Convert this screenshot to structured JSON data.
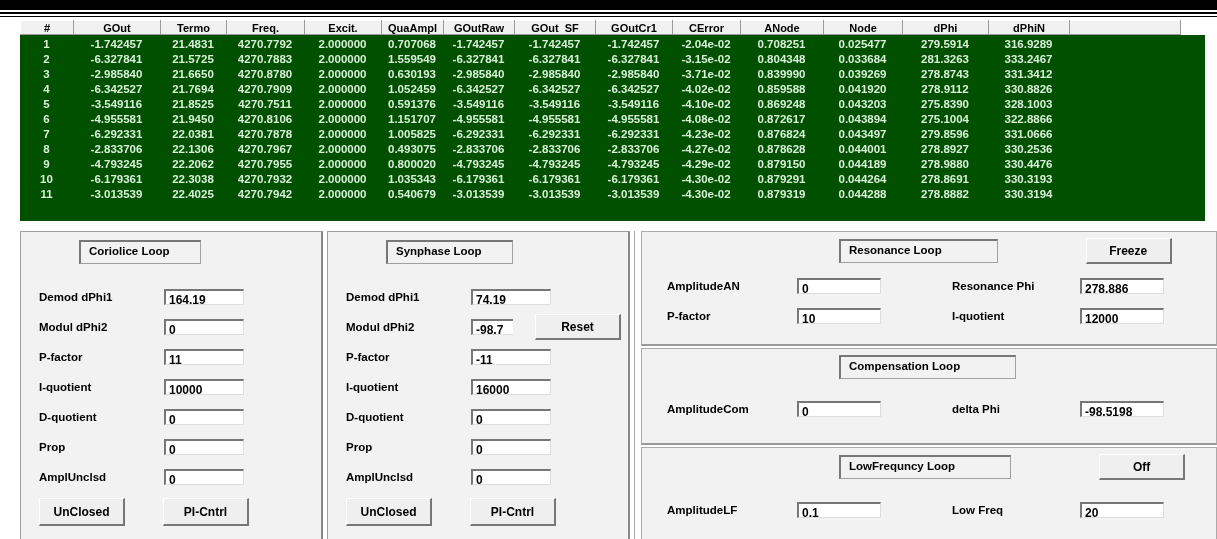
{
  "table": {
    "columns": [
      "#",
      "GOut",
      "Termo",
      "Freq.",
      "Excit.",
      "QuaAmpl",
      "GOutRaw",
      "GOut  SF",
      "GOutCr1",
      "CError",
      "ANode",
      "Node",
      "dPhi",
      "dPhiN"
    ],
    "rows": [
      [
        "1",
        "-1.742457",
        "21.4831",
        "4270.7792",
        "2.000000",
        "0.707068",
        "-1.742457",
        "-1.742457",
        "-1.742457",
        "-2.04e-02",
        "0.708251",
        "0.025477",
        "279.5914",
        "316.9289"
      ],
      [
        "2",
        "-6.327841",
        "21.5725",
        "4270.7883",
        "2.000000",
        "1.559549",
        "-6.327841",
        "-6.327841",
        "-6.327841",
        "-3.15e-02",
        "0.804348",
        "0.033684",
        "281.3263",
        "333.2467"
      ],
      [
        "3",
        "-2.985840",
        "21.6650",
        "4270.8780",
        "2.000000",
        "0.630193",
        "-2.985840",
        "-2.985840",
        "-2.985840",
        "-3.71e-02",
        "0.839990",
        "0.039269",
        "278.8743",
        "331.3412"
      ],
      [
        "4",
        "-6.342527",
        "21.7694",
        "4270.7909",
        "2.000000",
        "1.052459",
        "-6.342527",
        "-6.342527",
        "-6.342527",
        "-4.02e-02",
        "0.859588",
        "0.041920",
        "278.9112",
        "330.8826"
      ],
      [
        "5",
        "-3.549116",
        "21.8525",
        "4270.7511",
        "2.000000",
        "0.591376",
        "-3.549116",
        "-3.549116",
        "-3.549116",
        "-4.10e-02",
        "0.869248",
        "0.043203",
        "275.8390",
        "328.1003"
      ],
      [
        "6",
        "-4.955581",
        "21.9450",
        "4270.8106",
        "2.000000",
        "1.151707",
        "-4.955581",
        "-4.955581",
        "-4.955581",
        "-4.08e-02",
        "0.872617",
        "0.043894",
        "275.1004",
        "322.8866"
      ],
      [
        "7",
        "-6.292331",
        "22.0381",
        "4270.7878",
        "2.000000",
        "1.005825",
        "-6.292331",
        "-6.292331",
        "-6.292331",
        "-4.23e-02",
        "0.876824",
        "0.043497",
        "279.8596",
        "331.0666"
      ],
      [
        "8",
        "-2.833706",
        "22.1306",
        "4270.7967",
        "2.000000",
        "0.493075",
        "-2.833706",
        "-2.833706",
        "-2.833706",
        "-4.27e-02",
        "0.878628",
        "0.044001",
        "278.8927",
        "330.2536"
      ],
      [
        "9",
        "-4.793245",
        "22.2062",
        "4270.7955",
        "2.000000",
        "0.800020",
        "-4.793245",
        "-4.793245",
        "-4.793245",
        "-4.29e-02",
        "0.879150",
        "0.044189",
        "278.9880",
        "330.4476"
      ],
      [
        "10",
        "-6.179361",
        "22.3038",
        "4270.7932",
        "2.000000",
        "1.035343",
        "-6.179361",
        "-6.179361",
        "-6.179361",
        "-4.30e-02",
        "0.879291",
        "0.044264",
        "278.8691",
        "330.3193"
      ],
      [
        "11",
        "-3.013539",
        "22.4025",
        "4270.7942",
        "2.000000",
        "0.540679",
        "-3.013539",
        "-3.013539",
        "-3.013539",
        "-4.30e-02",
        "0.879319",
        "0.044288",
        "278.8882",
        "330.3194"
      ]
    ]
  },
  "loops": [
    {
      "title": "Coriolice Loop",
      "fields": [
        {
          "label": "Demod dPhi1",
          "value": "164.19"
        },
        {
          "label": "Modul dPhi2",
          "value": "0"
        },
        {
          "label": "P-factor",
          "value": "11"
        },
        {
          "label": "I-quotient",
          "value": "10000"
        },
        {
          "label": "D-quotient",
          "value": "0"
        },
        {
          "label": "Prop",
          "value": "0"
        },
        {
          "label": "AmplUnclsd",
          "value": "0"
        }
      ],
      "buttons": [
        "UnClosed",
        "PI-Cntrl"
      ]
    },
    {
      "title": "Synphase Loop",
      "fields": [
        {
          "label": "Demod dPhi1",
          "value": "74.19"
        },
        {
          "label": "Modul dPhi2",
          "value": "-98.7",
          "covered": true
        },
        {
          "label": "P-factor",
          "value": "-11"
        },
        {
          "label": "I-quotient",
          "value": "16000"
        },
        {
          "label": "D-quotient",
          "value": "0"
        },
        {
          "label": "Prop",
          "value": "0"
        },
        {
          "label": "AmplUnclsd",
          "value": "0"
        }
      ],
      "buttons": [
        "UnClosed",
        "PI-Cntrl"
      ],
      "overlay_button": "Reset"
    }
  ],
  "sections": [
    {
      "title": "Resonance Loop",
      "button": "Freeze",
      "fields": [
        {
          "label": "AmplitudeAN",
          "value": "0"
        },
        {
          "label": "Resonance Phi",
          "value": "278.886"
        },
        {
          "label": "P-factor",
          "value": "10"
        },
        {
          "label": "I-quotient",
          "value": "12000"
        }
      ]
    },
    {
      "title": "Compensation Loop",
      "fields": [
        {
          "label": "AmplitudeCom",
          "value": "0"
        },
        {
          "label": "delta Phi",
          "value": "-98.5198"
        }
      ]
    },
    {
      "title": "LowFrequncy Loop",
      "button": "Off",
      "fields": [
        {
          "label": "AmplitudeLF",
          "value": "0.1"
        },
        {
          "label": "Low Freq",
          "value": "20"
        }
      ]
    }
  ]
}
